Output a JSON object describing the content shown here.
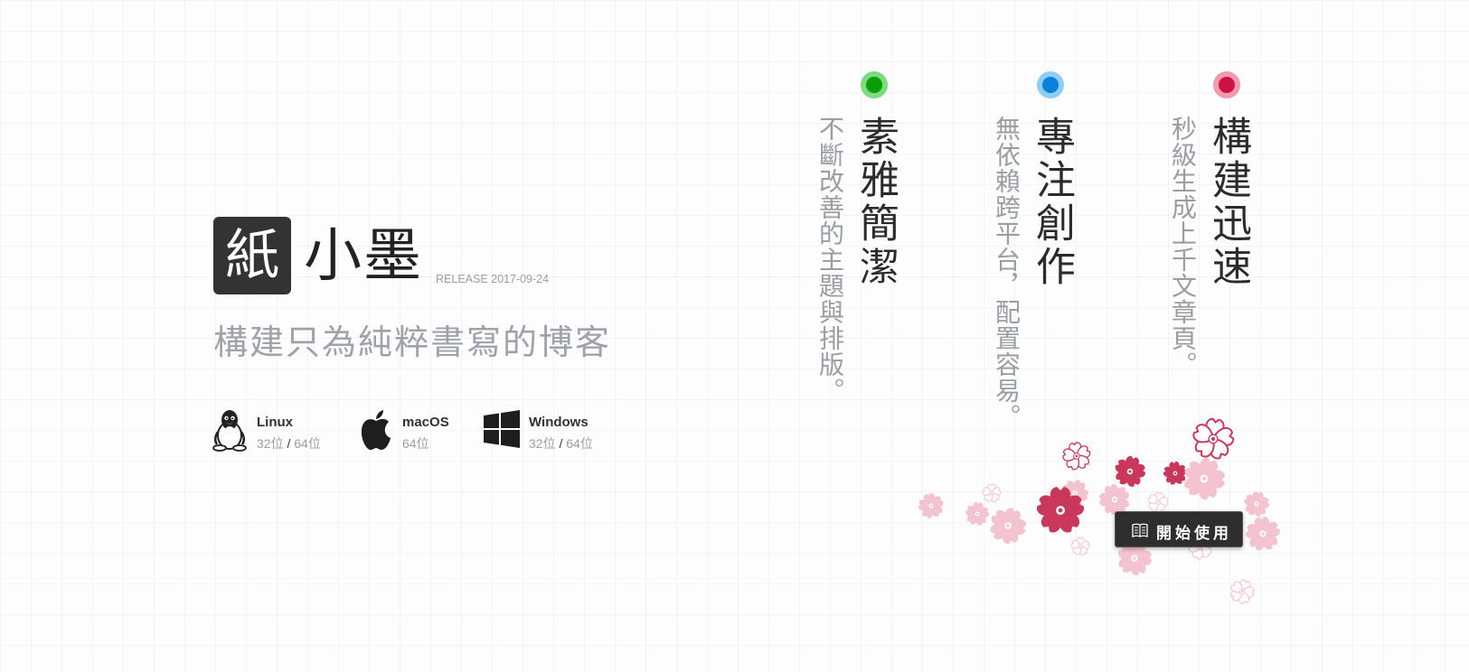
{
  "brand": {
    "logo_char": "紙",
    "name": "小墨",
    "release": "RELEASE 2017-09-24"
  },
  "tagline": "構建只為純粹書寫的博客",
  "platforms": [
    {
      "icon": "linux-icon",
      "name": "Linux",
      "arch_a": "32位",
      "sep": "/",
      "arch_b": "64位"
    },
    {
      "icon": "apple-icon",
      "name": "macOS",
      "arch_a": "64位"
    },
    {
      "icon": "windows-icon",
      "name": "Windows",
      "arch_a": "32位",
      "sep": "/",
      "arch_b": "64位"
    }
  ],
  "features": [
    {
      "title": "素雅簡潔",
      "desc": "不斷改善的主題與排版。",
      "dot_color": "#0a9d0a",
      "dot_ring": "#7ddb7d"
    },
    {
      "title": "專注創作",
      "desc": "無依賴跨平台，配置容易。",
      "dot_color": "#0c7fd8",
      "dot_ring": "#8ecdf6"
    },
    {
      "title": "構建迅速",
      "desc": "秒級生成上千文章頁。",
      "dot_color": "#cc1144",
      "dot_ring": "#f29ab0"
    }
  ],
  "start_button": {
    "label": "開始使用",
    "icon": "book-icon"
  },
  "colors": {
    "blossom_dark": "#c9385a",
    "blossom_light": "#f3c4cf"
  }
}
